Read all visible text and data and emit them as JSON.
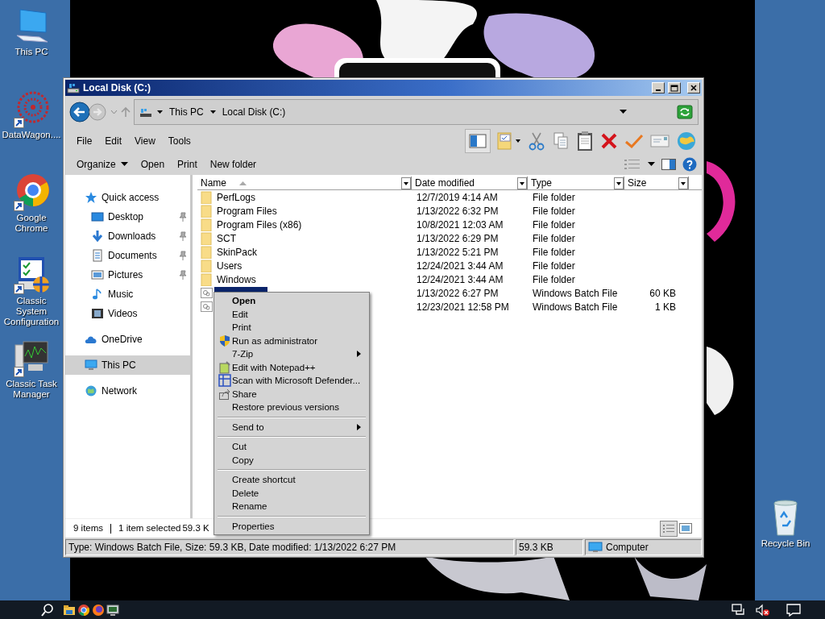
{
  "desktop_icons": [
    {
      "label": "This PC",
      "shortcut": false
    },
    {
      "label": "DataWagon....",
      "shortcut": true
    },
    {
      "label": "Google Chrome",
      "shortcut": true
    },
    {
      "label": "Classic System Configuration",
      "shortcut": true
    },
    {
      "label": "Classic Task Manager",
      "shortcut": true
    },
    {
      "label": "Recycle Bin",
      "shortcut": false
    }
  ],
  "window": {
    "title": "Local Disk (C:)",
    "address": {
      "crumbs": [
        "This PC",
        "Local Disk (C:)"
      ]
    },
    "menu": [
      "File",
      "Edit",
      "View",
      "Tools"
    ],
    "commands": [
      {
        "label": "Organize",
        "dropdown": true
      },
      {
        "label": "Open",
        "dropdown": false
      },
      {
        "label": "Print",
        "dropdown": false
      },
      {
        "label": "New folder",
        "dropdown": false
      }
    ],
    "sidebar": {
      "items": [
        {
          "label": "Quick access",
          "selected": false,
          "children": [
            {
              "label": "Desktop",
              "pinned": true,
              "selected": false
            },
            {
              "label": "Downloads",
              "pinned": true,
              "selected": false
            },
            {
              "label": "Documents",
              "pinned": true,
              "selected": false
            },
            {
              "label": "Pictures",
              "pinned": true,
              "selected": false
            },
            {
              "label": "Music",
              "pinned": false,
              "selected": false
            },
            {
              "label": "Videos",
              "pinned": false,
              "selected": false
            }
          ]
        },
        {
          "label": "OneDrive",
          "selected": false
        },
        {
          "label": "This PC",
          "selected": true
        },
        {
          "label": "Network",
          "selected": false
        }
      ]
    },
    "table": {
      "columns": [
        {
          "label": "Name",
          "sorted": true
        },
        {
          "label": "Date modified",
          "sorted": false
        },
        {
          "label": "Type",
          "sorted": false
        },
        {
          "label": "Size",
          "sorted": false
        }
      ],
      "rows": [
        {
          "kind": "folder",
          "name": "PerfLogs",
          "date": "12/7/2019 4:14 AM",
          "type": "File folder",
          "selected": false
        },
        {
          "kind": "folder",
          "name": "Program Files",
          "date": "1/13/2022 6:32 PM",
          "type": "File folder",
          "selected": false
        },
        {
          "kind": "folder",
          "name": "Program Files (x86)",
          "date": "10/8/2021 12:03 AM",
          "type": "File folder",
          "selected": false
        },
        {
          "kind": "folder",
          "name": "SCT",
          "date": "1/13/2022 6:29 PM",
          "type": "File folder",
          "selected": false
        },
        {
          "kind": "folder",
          "name": "SkinPack",
          "date": "1/13/2022 5:21 PM",
          "type": "File folder",
          "selected": false
        },
        {
          "kind": "folder",
          "name": "Users",
          "date": "12/24/2021 3:44 AM",
          "type": "File folder",
          "selected": false
        },
        {
          "kind": "folder",
          "name": "Windows",
          "date": "12/24/2021 3:44 AM",
          "type": "File folder",
          "selected": false
        },
        {
          "kind": "batch",
          "date": "1/13/2022 6:27 PM",
          "type": "Windows Batch File",
          "size": "60 KB",
          "selected": true
        },
        {
          "kind": "batch",
          "date": "12/23/2021 12:58 PM",
          "type": "Windows Batch File",
          "size": "1 KB",
          "selected": false
        }
      ]
    },
    "details": {
      "count": "9 items",
      "selection": "1 item selected",
      "size": "59.3 K"
    },
    "status_bar": {
      "description": "Type: Windows Batch File, Size: 59.3 KB, Date modified: 1/13/2022 6:27 PM",
      "size": "59.3 KB",
      "zone": "Computer"
    }
  },
  "context_menu": {
    "groups": [
      [
        {
          "label": "Open",
          "default": true,
          "submenu": false
        },
        {
          "label": "Edit",
          "default": false,
          "submenu": false
        },
        {
          "label": "Print",
          "default": false,
          "submenu": false
        },
        {
          "label": "Run as administrator",
          "default": false,
          "submenu": false
        },
        {
          "label": "7-Zip",
          "default": false,
          "submenu": true
        },
        {
          "label": "Edit with Notepad++",
          "default": false,
          "submenu": false
        },
        {
          "label": "Scan with Microsoft Defender...",
          "default": false,
          "submenu": false
        },
        {
          "label": "Share",
          "default": false,
          "submenu": false
        },
        {
          "label": "Restore previous versions",
          "default": false,
          "submenu": false
        }
      ],
      [
        {
          "label": "Send to",
          "default": false,
          "submenu": true
        }
      ],
      [
        {
          "label": "Cut",
          "default": false,
          "submenu": false
        },
        {
          "label": "Copy",
          "default": false,
          "submenu": false
        }
      ],
      [
        {
          "label": "Create shortcut",
          "default": false,
          "submenu": false
        },
        {
          "label": "Delete",
          "default": false,
          "submenu": false
        },
        {
          "label": "Rename",
          "default": false,
          "submenu": false
        }
      ],
      [
        {
          "label": "Properties",
          "default": false,
          "submenu": false
        }
      ]
    ]
  }
}
